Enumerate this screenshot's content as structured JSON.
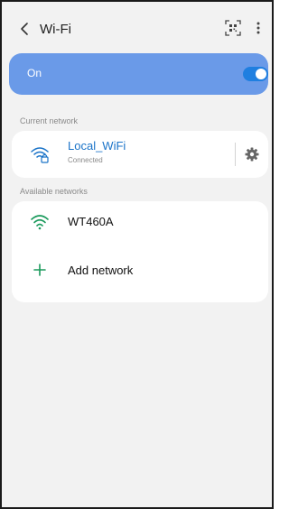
{
  "header": {
    "title": "Wi-Fi",
    "back_icon": "chevron-left-icon",
    "qr_icon": "qr-scan-icon",
    "more_icon": "more-vertical-icon"
  },
  "master_switch": {
    "label": "On",
    "state": true,
    "row_color": "#6a9ae8",
    "toggle_color": "#1f7fe0"
  },
  "current_network": {
    "section_label": "Current network",
    "name": "Local_WiFi",
    "status": "Connected",
    "icon": "wifi-locked-icon",
    "settings_icon": "gear-icon",
    "name_color": "#1a73c8"
  },
  "available_networks": {
    "section_label": "Available networks",
    "networks": [
      {
        "name": "WT460A",
        "icon": "wifi-icon"
      }
    ],
    "add_network_label": "Add network",
    "add_icon": "plus-icon",
    "accent_color": "#1a9a5c"
  }
}
